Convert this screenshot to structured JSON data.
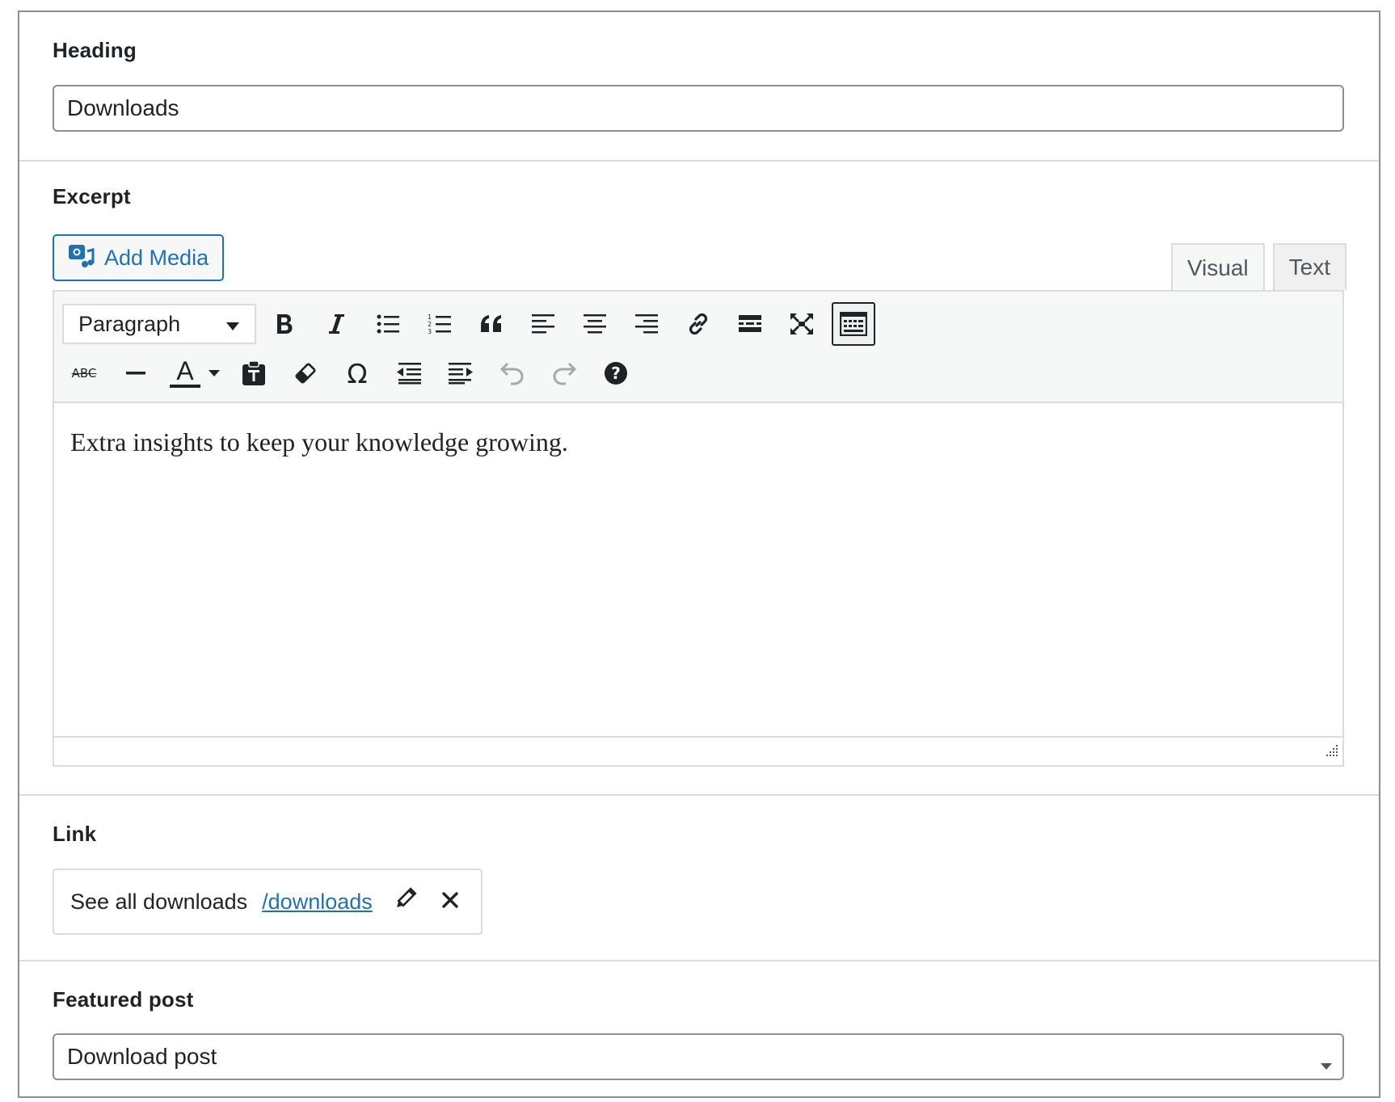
{
  "heading": {
    "label": "Heading",
    "value": "Downloads"
  },
  "excerpt": {
    "label": "Excerpt",
    "add_media_label": "Add Media",
    "tabs": [
      {
        "label": "Visual",
        "active": true
      },
      {
        "label": "Text",
        "active": false
      }
    ],
    "toolbar": {
      "format_value": "Paragraph",
      "row1_icons": [
        "bold-icon",
        "italic-icon",
        "bulleted-list-icon",
        "numbered-list-icon",
        "blockquote-icon",
        "align-left-icon",
        "align-center-icon",
        "align-right-icon",
        "link-icon",
        "read-more-icon",
        "fullscreen-icon",
        "toolbar-toggle-icon"
      ],
      "row2_icons": [
        "strikethrough-icon",
        "horizontal-line-icon",
        "text-color-icon",
        "paste-text-icon",
        "clear-formatting-icon",
        "special-character-icon",
        "outdent-icon",
        "indent-icon",
        "undo-icon",
        "redo-icon",
        "help-icon"
      ],
      "strikethrough_glyph": "ABC",
      "text_color_glyph": "A",
      "special_character_glyph": "Ω"
    },
    "content": "Extra insights to keep your knowledge growing."
  },
  "link": {
    "label": "Link",
    "title": "See all downloads",
    "url": "/downloads"
  },
  "featured": {
    "label": "Featured post",
    "selected": "Download post"
  },
  "colors": {
    "accent": "#2271b1",
    "text": "#1d2327",
    "border": "#8c8f94",
    "divider": "#dcdcde",
    "toolbar_bg": "#f6f7f7",
    "disabled": "#a7aaad"
  }
}
